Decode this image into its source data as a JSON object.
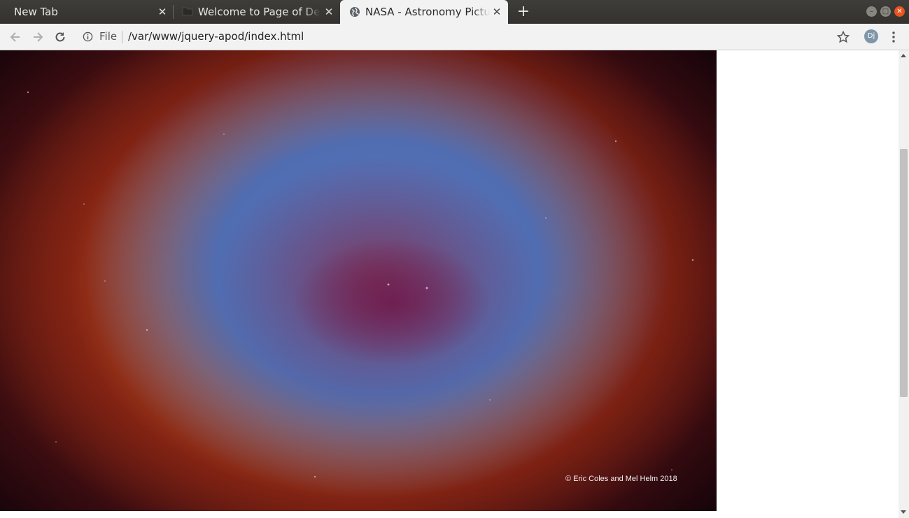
{
  "tabs": [
    {
      "label": "New Tab",
      "favicon": "none"
    },
    {
      "label": "Welcome to Page of Denn",
      "favicon": "folder-icon"
    },
    {
      "label": "NASA - Astronomy Picture",
      "favicon": "globe-icon",
      "active": true
    }
  ],
  "tab_close_glyph": "✕",
  "new_tab_glyph": "+",
  "window": {
    "minimize": "–",
    "maximize": "□",
    "close": "✕"
  },
  "toolbar": {
    "back_icon": "arrow-left-icon",
    "forward_icon": "arrow-right-icon",
    "reload_icon": "reload-icon",
    "info_icon": "info-icon",
    "scheme_label": "File",
    "url": "/var/www/jquery-apod/index.html",
    "bookmark_icon": "star-icon",
    "profile_initials": "Dj",
    "menu_icon": "kebab-menu-icon"
  },
  "page": {
    "image_credit": "© Eric Coles and Mel Helm 2018"
  },
  "colors": {
    "tabstrip": "#3e3d39",
    "toolbar": "#f2f2f2",
    "window_close": "#e9541f",
    "avatar": "#7e96a7"
  }
}
